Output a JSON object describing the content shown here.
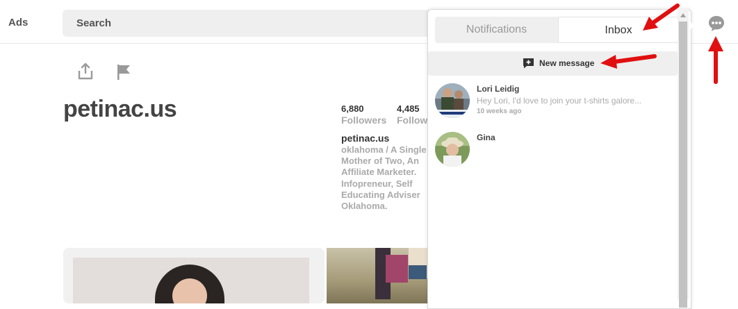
{
  "header": {
    "ads_label": "Ads",
    "search_placeholder": "Search"
  },
  "profile": {
    "name": "petinac.us",
    "stats": [
      {
        "count": "6,880",
        "label": "Followers"
      },
      {
        "count": "4,485",
        "label": "Follow"
      }
    ],
    "bio_title": "petinac.us",
    "bio_lines": [
      "oklahoma / A Single",
      "Mother of Two, An",
      "Affiliate Marketer.",
      "Infopreneur, Self",
      "Educating Adviser",
      "Oklahoma."
    ]
  },
  "panel": {
    "tabs": {
      "notifications": "Notifications",
      "inbox": "Inbox"
    },
    "new_message_label": "New message",
    "conversations": [
      {
        "name": "Lori Leidig",
        "preview": "Hey Lori, I'd love to join your t-shirts galore...",
        "time": "10 weeks ago"
      },
      {
        "name": "Gina",
        "preview": "",
        "time": ""
      }
    ]
  },
  "colors": {
    "annotation_arrow": "#e01010",
    "panel_bg": "#ffffff",
    "tab_inactive_bg": "#efefef"
  },
  "icons": [
    "share-icon",
    "flag-icon",
    "chat-icon",
    "new-message-icon",
    "annotation-arrow"
  ]
}
